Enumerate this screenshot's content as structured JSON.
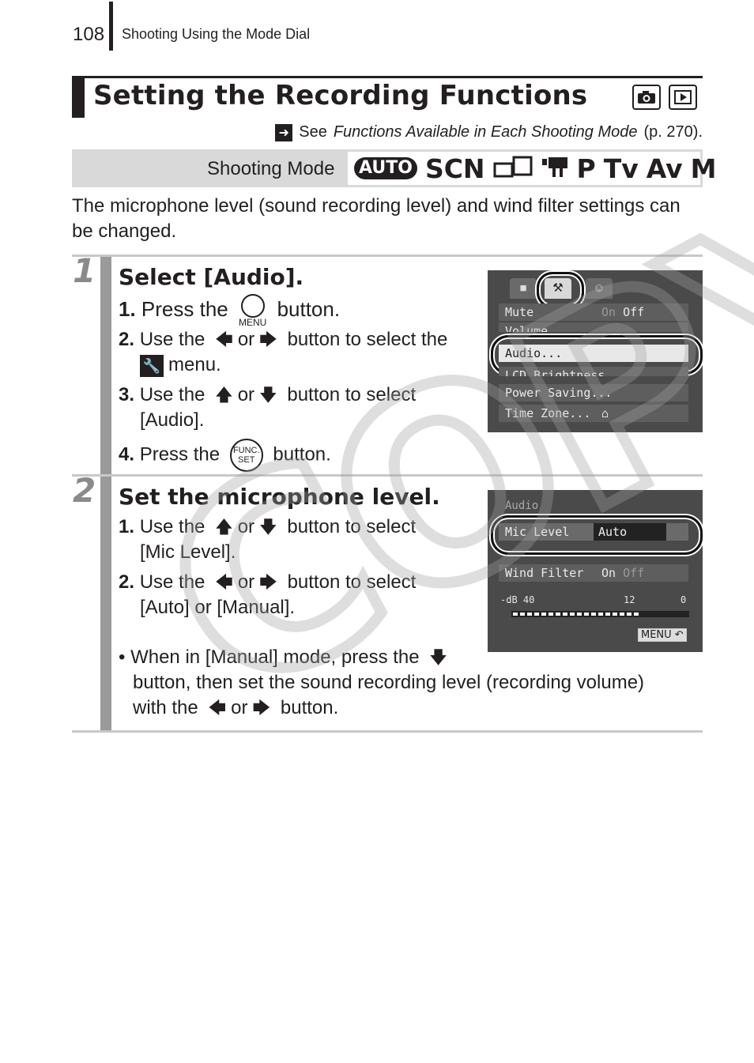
{
  "header": {
    "page_number": "108",
    "section": "Shooting Using the Mode Dial"
  },
  "title": "Setting the Recording Functions",
  "mode_icons": [
    "camera-icon",
    "playback-icon"
  ],
  "see_also": {
    "prefix": "See",
    "link_text": "Functions Available in Each Shooting Mode",
    "suffix": "(p. 270)."
  },
  "shooting_mode": {
    "label": "Shooting Mode",
    "modes": [
      "AUTO",
      "SCN",
      "▭□",
      "▼▮",
      "P",
      "Tv",
      "Av",
      "M"
    ]
  },
  "intro": "The microphone level (sound recording level) and wind filter settings can be changed.",
  "steps": [
    {
      "number": "1",
      "title": "Select [Audio].",
      "items": {
        "i1": {
          "num": "1.",
          "pre": "Press the",
          "btn_label": "MENU",
          "post": "button."
        },
        "i2": {
          "num": "2.",
          "pre": "Use the",
          "or": "or",
          "post": "button to select the",
          "cont": "menu."
        },
        "i3": {
          "num": "3.",
          "pre": "Use the",
          "or": "or",
          "post": "button to select",
          "cont": "[Audio]."
        },
        "i4": {
          "num": "4.",
          "pre": "Press the",
          "btn_top": "FUNC.",
          "btn_bottom": "SET",
          "post": "button."
        }
      },
      "screen": {
        "tabs": [
          "■",
          "⚒",
          "☺"
        ],
        "rows": [
          {
            "label": "Mute",
            "value_on": "On",
            "value_off": "Off"
          },
          {
            "label": "Volume",
            "value": ""
          },
          {
            "label": "Audio...",
            "value": ""
          },
          {
            "label": "LCD Brightness",
            "value": ""
          },
          {
            "label": "Power Saving...",
            "value": ""
          },
          {
            "label": "Time Zone...",
            "value": "⌂"
          }
        ]
      }
    },
    {
      "number": "2",
      "title": "Set the microphone level.",
      "items": {
        "i1": {
          "num": "1.",
          "pre": "Use the",
          "or": "or",
          "post": "button to select",
          "cont": "[Mic Level]."
        },
        "i2": {
          "num": "2.",
          "pre": "Use the",
          "or": "or",
          "post": "button to select",
          "cont": "[Auto] or [Manual]."
        }
      },
      "note": {
        "l1_pre": "When in [Manual] mode, press the",
        "l2": "button, then set the sound recording level (recording volume)",
        "l3_pre": "with the",
        "l3_or": "or",
        "l3_post": "button."
      },
      "screen": {
        "heading": "Audio",
        "rows": [
          {
            "label": "Mic Level",
            "value": "Auto"
          },
          {
            "label": "Wind Filter",
            "value_on": "On",
            "value_off": "Off"
          }
        ],
        "scale": {
          "left": "-dB 40",
          "mid": "12",
          "right": "0"
        },
        "level_fraction": 0.72,
        "menu_key": "MENU ↶"
      }
    }
  ],
  "watermark": "COPY"
}
